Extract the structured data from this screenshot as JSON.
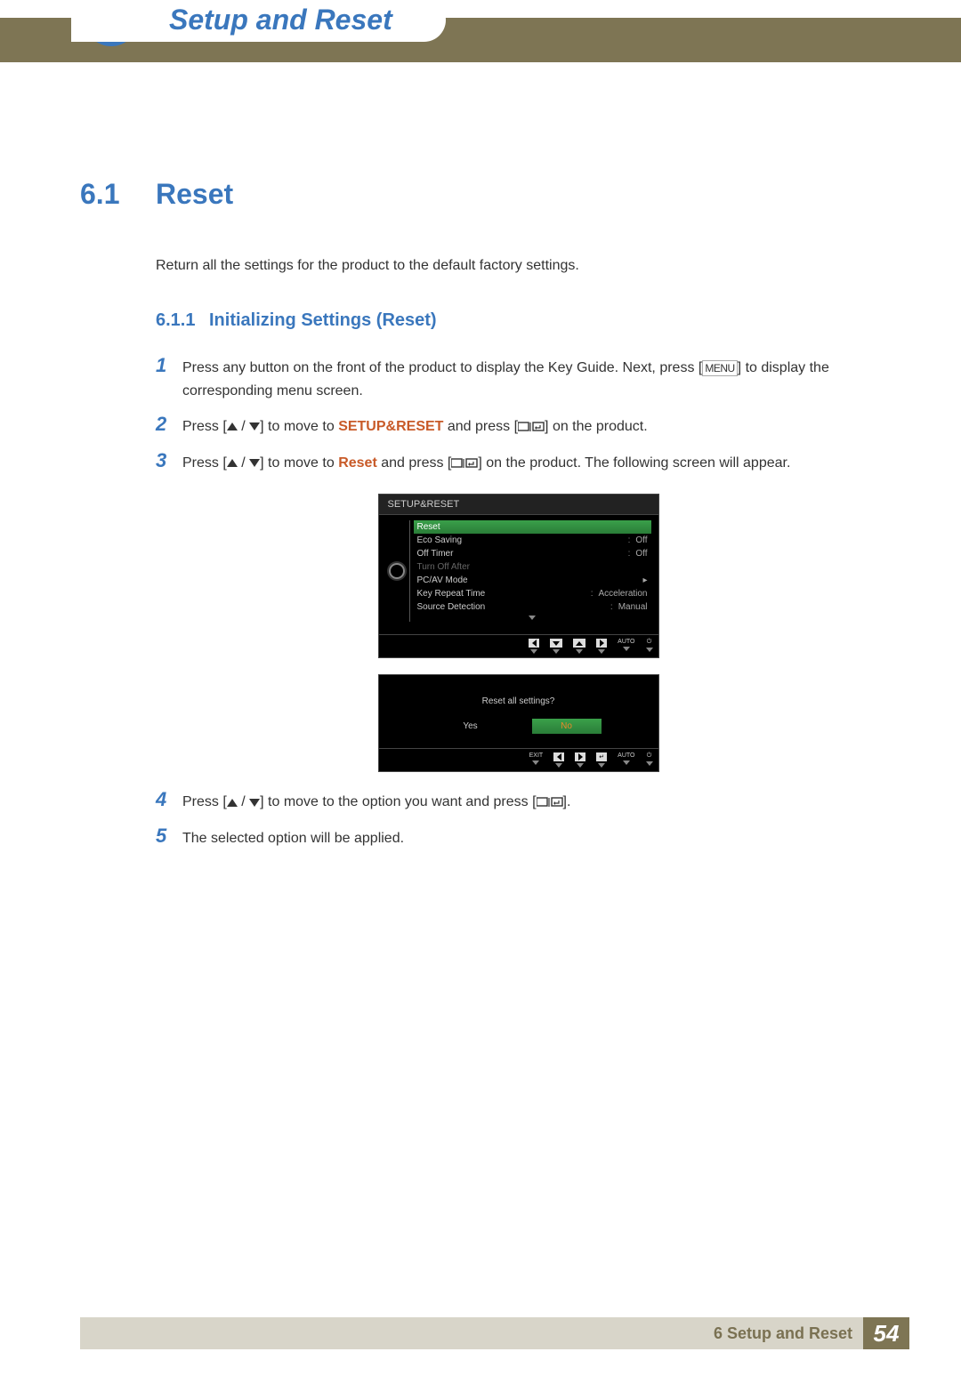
{
  "header": {
    "title": "Setup and Reset"
  },
  "section": {
    "number": "6.1",
    "title": "Reset",
    "description": "Return all the settings for the product to the default factory settings."
  },
  "subsection": {
    "number": "6.1.1",
    "title": "Initializing Settings (Reset)"
  },
  "steps": {
    "s1": {
      "num": "1",
      "pre": "Press any button on the front of the product to display the Key Guide. Next, press [",
      "menu": "MENU",
      "post": "] to display the corresponding menu screen."
    },
    "s2": {
      "num": "2",
      "pre": "Press [",
      "mid": "] to move to ",
      "kw": "SETUP&RESET",
      "mid2": " and press [",
      "post": "] on the product."
    },
    "s3": {
      "num": "3",
      "pre": "Press [",
      "mid": "] to move to ",
      "kw": "Reset",
      "mid2": " and press [",
      "post": "] on the product. The following screen will appear."
    },
    "s4": {
      "num": "4",
      "pre": "Press [",
      "mid": "] to move to the option you want and press [",
      "post": "]."
    },
    "s5": {
      "num": "5",
      "text": "The selected option will be applied."
    }
  },
  "osd": {
    "title": "SETUP&RESET",
    "items": [
      {
        "label": "Reset",
        "value": "",
        "selected": true
      },
      {
        "label": "Eco Saving",
        "value": "Off"
      },
      {
        "label": "Off Timer",
        "value": "Off"
      },
      {
        "label": "Turn Off After",
        "value": "",
        "disabled": true
      },
      {
        "label": "PC/AV Mode",
        "value": "",
        "arrow": true
      },
      {
        "label": "Key Repeat Time",
        "value": "Acceleration"
      },
      {
        "label": "Source Detection",
        "value": "Manual"
      }
    ],
    "footer_auto": "AUTO"
  },
  "osd2": {
    "question": "Reset all settings?",
    "yes": "Yes",
    "no": "No",
    "exit": "EXIT",
    "auto": "AUTO"
  },
  "footer": {
    "text": "6 Setup and Reset",
    "page": "54"
  }
}
